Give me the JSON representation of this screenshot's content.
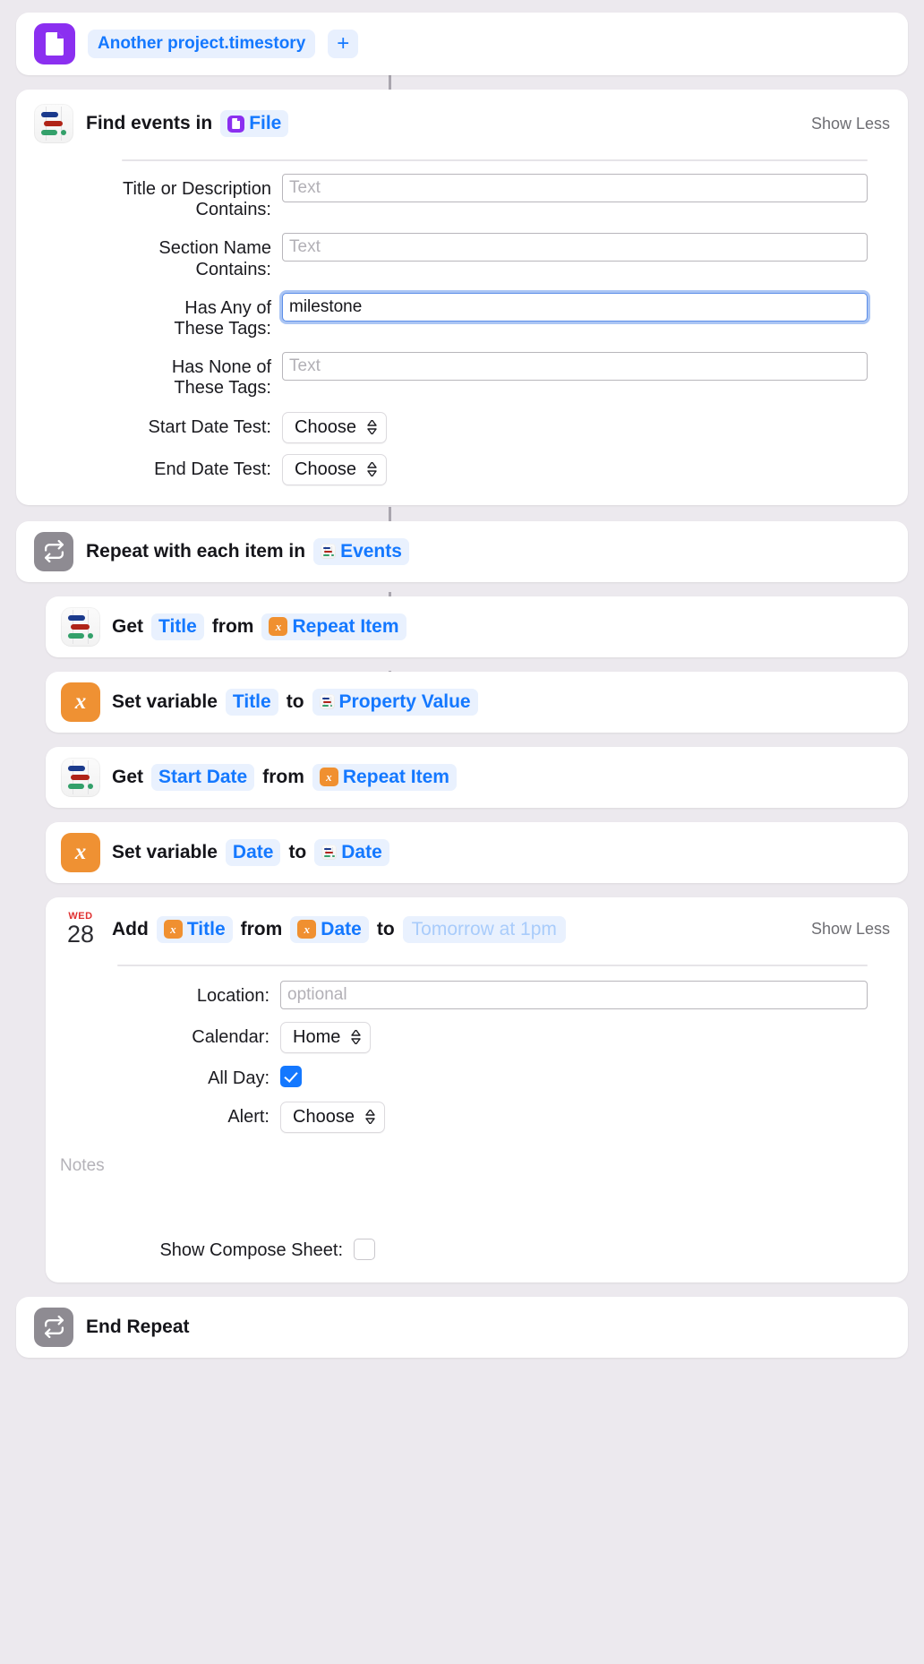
{
  "trigger": {
    "app_icon": "file-document-icon",
    "file_pill": "Another project.timestory",
    "add_label": "+"
  },
  "find_action": {
    "icon": "timestory-app-icon",
    "title_prefix": "Find events in",
    "source_pill": "File",
    "source_icon": "file-document-icon",
    "show_less": "Show Less",
    "fields": [
      {
        "label": "Title or Description\nContains:",
        "placeholder": "Text",
        "value": "",
        "focused": false
      },
      {
        "label": "Section Name\nContains:",
        "placeholder": "Text",
        "value": "",
        "focused": false
      },
      {
        "label": "Has Any of\nThese Tags:",
        "placeholder": "Text",
        "value": "milestone",
        "focused": true
      },
      {
        "label": "Has None of\nThese Tags:",
        "placeholder": "Text",
        "value": "",
        "focused": false
      }
    ],
    "selects": [
      {
        "label": "Start Date Test:",
        "value": "Choose"
      },
      {
        "label": "End Date Test:",
        "value": "Choose"
      }
    ]
  },
  "repeat": {
    "icon": "repeat-loop-icon",
    "title_prefix": "Repeat with each item in",
    "list_pill": "Events",
    "list_icon": "timestory-app-icon"
  },
  "steps": [
    {
      "icon": "timestory-app-icon",
      "icon_type": "timestory",
      "word1": "Get",
      "pill1": "Title",
      "word2": "from",
      "pill2": "Repeat Item",
      "pill2_icon": "variable-x-icon"
    },
    {
      "icon": "variable-x-icon",
      "icon_type": "variable",
      "word1": "Set variable",
      "pill1": "Title",
      "word2": "to",
      "pill2": "Property Value",
      "pill2_icon": "timestory-app-icon"
    },
    {
      "icon": "timestory-app-icon",
      "icon_type": "timestory",
      "word1": "Get",
      "pill1": "Start Date",
      "word2": "from",
      "pill2": "Repeat Item",
      "pill2_icon": "variable-x-icon"
    },
    {
      "icon": "variable-x-icon",
      "icon_type": "variable",
      "word1": "Set variable",
      "pill1": "Date",
      "word2": "to",
      "pill2": "Date",
      "pill2_icon": "timestory-app-icon"
    }
  ],
  "calendar_action": {
    "icon_weekday": "WED",
    "icon_day": "28",
    "word1": "Add",
    "pill1": "Title",
    "pill1_icon": "variable-x-icon",
    "word2": "from",
    "pill2": "Date",
    "pill2_icon": "variable-x-icon",
    "word3": "to",
    "ghost_pill": "Tomorrow at 1pm",
    "show_less": "Show Less",
    "location_label": "Location:",
    "location_placeholder": "optional",
    "location_value": "",
    "calendar_label": "Calendar:",
    "calendar_value": "Home",
    "allday_label": "All Day:",
    "allday_checked": true,
    "alert_label": "Alert:",
    "alert_value": "Choose",
    "notes_placeholder": "Notes",
    "notes_value": "",
    "compose_label": "Show Compose Sheet:",
    "compose_checked": false
  },
  "end_repeat": {
    "icon": "repeat-loop-icon",
    "label": "End Repeat"
  },
  "colors": {
    "accent_blue": "#1478ff",
    "purple": "#8b2ff0",
    "orange": "#ef9133",
    "gray_icon": "#8e8b92",
    "background": "#ece9ee"
  }
}
